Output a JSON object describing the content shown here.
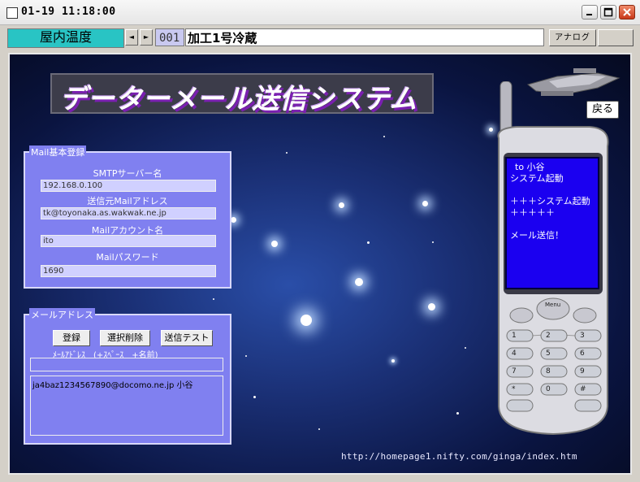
{
  "window": {
    "title": "01-19 11:18:00"
  },
  "toolbar": {
    "location_label": "屋内温度",
    "prev_glyph": "◄",
    "next_glyph": "►",
    "code": "001",
    "name": "加工1号冷蔵",
    "analog_label": "アナログ"
  },
  "banner": {
    "title": "データーメール送信システム"
  },
  "mail_settings": {
    "legend": "Mail基本登録",
    "smtp_label": "SMTPサーバー名",
    "smtp_value": "192.168.0.100",
    "from_label": "送信元Mailアドレス",
    "from_value": "tk@toyonaka.as.wakwak.ne.jp",
    "account_label": "Mailアカウント名",
    "account_value": "ito",
    "password_label": "Mailパスワード",
    "password_value": "1690"
  },
  "mail_address": {
    "legend": "メールアドレス",
    "register_label": "登録",
    "delete_label": "選択削除",
    "test_label": "送信テスト",
    "hint": "ﾒｰﾙｱﾄﾞﾚｽ　(+ｽﾍﾟｰｽ　+名前)",
    "input_value": "",
    "entries": [
      "ja4baz1234567890@docomo.ne.jp 小谷"
    ]
  },
  "phone": {
    "back_label": "戻る",
    "screen_lines": [
      "to 小谷",
      "システム起動",
      "",
      "＋＋＋システム起動＋＋＋＋＋",
      "",
      "メール送信！"
    ],
    "menu_label": "Menu",
    "keys": [
      "1",
      "2",
      "3",
      "4",
      "5",
      "6",
      "7",
      "8",
      "9",
      "*",
      "0",
      "#"
    ]
  },
  "footer": {
    "url": "http://homepage1.nifty.com/ginga/index.htm"
  },
  "colors": {
    "accent_cyan": "#29c4c4",
    "panel_blue": "#8080f0",
    "screen_blue": "#1b00f0",
    "banner_shadow": "#7a1fb0"
  }
}
